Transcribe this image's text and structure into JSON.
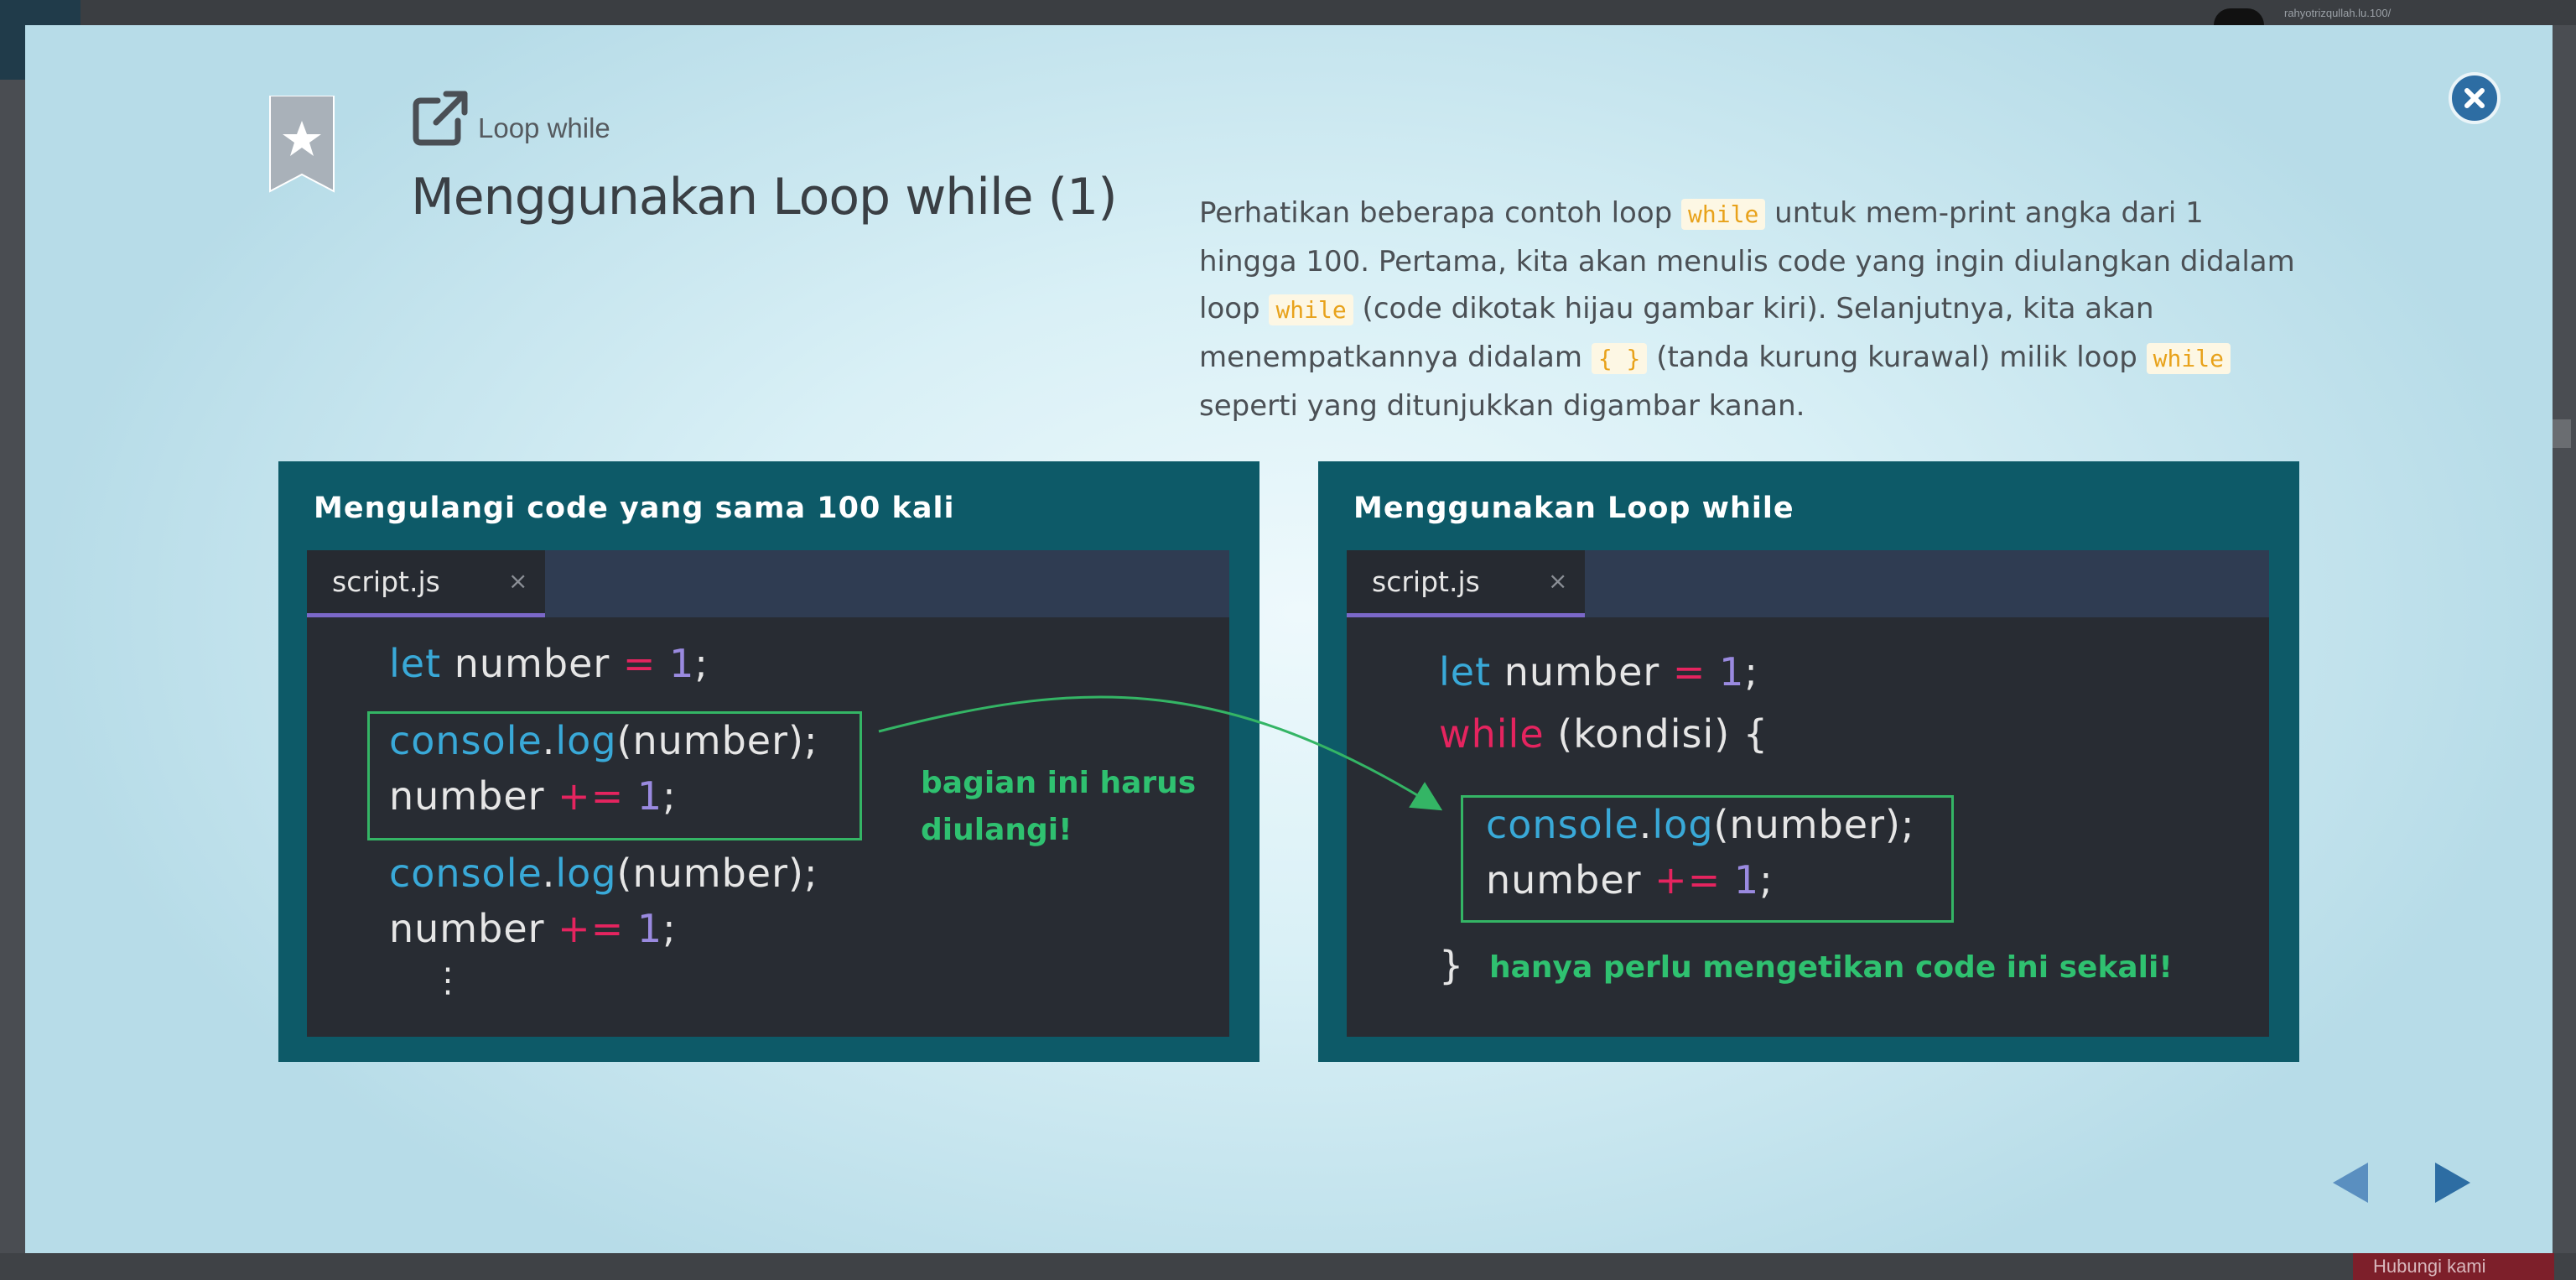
{
  "background": {
    "username": "rahyotrizqullah.lu.100/",
    "footer_button": "Hubungi kami"
  },
  "modal": {
    "breadcrumb": "Loop while",
    "title": "Menggunakan Loop while (1)",
    "description": {
      "p1": "Perhatikan beberapa contoh loop ",
      "kw1": "while",
      "p2": " untuk mem-print angka dari 1 hingga 100. Pertama, kita akan menulis code yang ingin diulangkan didalam loop ",
      "kw2": "while",
      "p3": " (code dikotak hijau gambar kiri). Selanjutnya, kita akan menempatkannya didalam ",
      "kw3": "{ }",
      "p4": " (tanda kurung kurawal) milik loop ",
      "kw4": "while",
      "p5": " seperti yang ditunjukkan digambar kanan."
    },
    "left_panel": {
      "heading": "Mengulangi code yang sama 100 kali",
      "tab": "script.js",
      "tab_close": "×",
      "line1": {
        "kw": "let",
        "name": " number ",
        "op": "=",
        "num": " 1",
        "end": ";"
      },
      "line2": {
        "obj": "console",
        "dot": ".",
        "fn": "log",
        "rest": "(number);"
      },
      "line3": {
        "name": "number ",
        "op": "+=",
        "num": " 1",
        "end": ";"
      },
      "line4": {
        "obj": "console",
        "dot": ".",
        "fn": "log",
        "rest": "(number);"
      },
      "line5": {
        "name": "number ",
        "op": "+=",
        "num": " 1",
        "end": ";"
      },
      "ellipsis": "⋮",
      "note_line1": "bagian ini harus",
      "note_line2": "diulangi!"
    },
    "right_panel": {
      "heading": "Menggunakan Loop while",
      "tab": "script.js",
      "tab_close": "×",
      "line1": {
        "kw": "let",
        "name": " number ",
        "op": "=",
        "num": " 1",
        "end": ";"
      },
      "line2": {
        "kw": "while",
        "rest": " (kondisi) {"
      },
      "line3": {
        "obj": "console",
        "dot": ".",
        "fn": "log",
        "rest": "(number);"
      },
      "line4": {
        "name": "number ",
        "op": "+=",
        "num": " 1",
        "end": ";"
      },
      "close_brace": "}",
      "note": "hanya perlu mengetikan code ini sekali!"
    }
  },
  "colors": {
    "accent_blue": "#2d6da3",
    "panel_bg": "#0d5a68",
    "editor_bg": "#282c33",
    "highlight_green": "#34b565",
    "keyword_orange": "#e8a21b"
  }
}
